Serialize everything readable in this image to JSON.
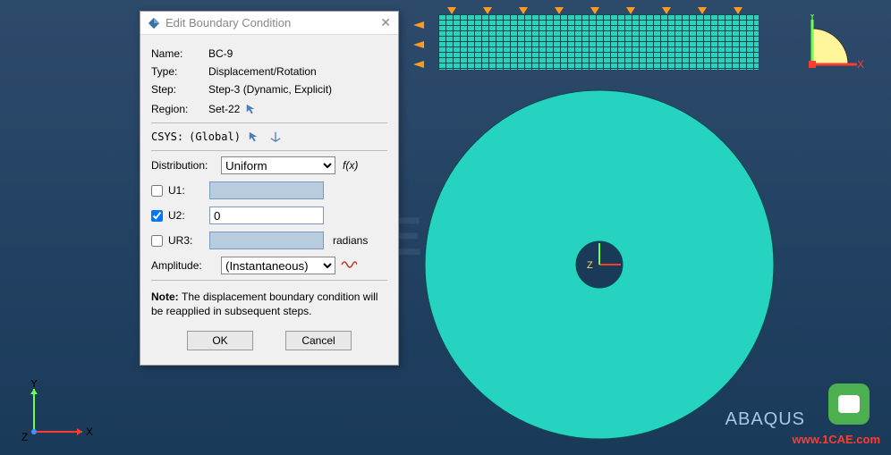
{
  "dialog": {
    "title": "Edit Boundary Condition",
    "fields": {
      "name_label": "Name:",
      "name_value": "BC-9",
      "type_label": "Type:",
      "type_value": "Displacement/Rotation",
      "step_label": "Step:",
      "step_value": "Step-3 (Dynamic, Explicit)",
      "region_label": "Region:",
      "region_value": "Set-22"
    },
    "csys_label": "CSYS:",
    "csys_value": "(Global)",
    "distribution_label": "Distribution:",
    "distribution_value": "Uniform",
    "fx_label": "f(x)",
    "dof": {
      "u1_label": "U1:",
      "u1_checked": false,
      "u1_value": "",
      "u2_label": "U2:",
      "u2_checked": true,
      "u2_value": "0",
      "ur3_label": "UR3:",
      "ur3_checked": false,
      "ur3_value": "",
      "ur3_unit": "radians"
    },
    "amplitude_label": "Amplitude:",
    "amplitude_value": "(Instantaneous)",
    "note_label": "Note:",
    "note_text": "The displacement boundary condition will be reapplied in subsequent steps.",
    "ok_label": "OK",
    "cancel_label": "Cancel"
  },
  "viewport": {
    "axis_y": "Y",
    "axis_x": "X",
    "axis_z": "Z",
    "brand": "ABAQUS",
    "watermark": "www.1CAE.com",
    "bg_watermark": "1CAE"
  }
}
